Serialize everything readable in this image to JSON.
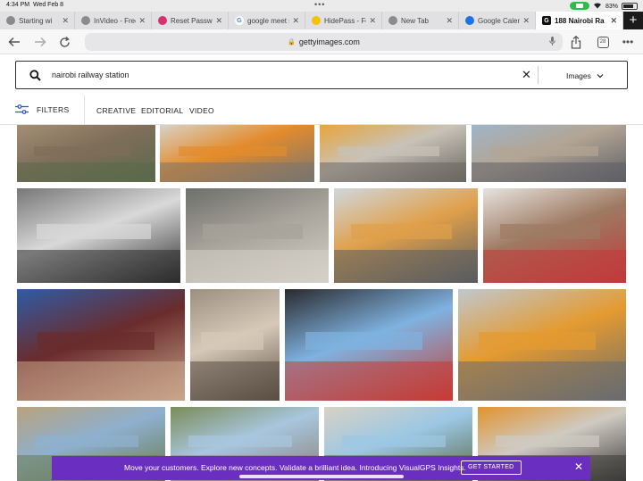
{
  "status": {
    "time": "4:34 PM",
    "date": "Wed Feb 8",
    "battery": "83%"
  },
  "tabs": [
    {
      "title": "Starting wi",
      "favicon": "globe-icon",
      "color": "#8a8a8a"
    },
    {
      "title": "InVideo - Free",
      "favicon": "globe-icon",
      "color": "#8a8a8a"
    },
    {
      "title": "Reset Passwo",
      "favicon": "instagram-icon",
      "color": "#d6306f"
    },
    {
      "title": "google meet s",
      "favicon": "google-icon",
      "color": "#4285f4"
    },
    {
      "title": "HidePass - Fo",
      "favicon": "hidepass-icon",
      "color": "#f3c200"
    },
    {
      "title": "New Tab",
      "favicon": "globe-icon",
      "color": "#8a8a8a"
    },
    {
      "title": "Google Calend",
      "favicon": "calendar-icon",
      "color": "#1a73e8"
    },
    {
      "title": "188 Nairobi Ra",
      "favicon": "getty-icon",
      "color": "#111111",
      "active": true
    }
  ],
  "toolbar": {
    "url": "gettyimages.com",
    "tab_count": "28"
  },
  "search": {
    "query": "nairobi railway station",
    "type": "Images"
  },
  "filters": {
    "label": "FILTERS",
    "tabs": [
      "CREATIVE",
      "EDITORIAL",
      "VIDEO"
    ]
  },
  "images": [
    {
      "row": 1,
      "subject": "railway-coaches-yard",
      "palette": [
        "#7f6e5a",
        "#a48f74",
        "#5a6a4a"
      ]
    },
    {
      "row": 1,
      "subject": "sgr-train-platform",
      "palette": [
        "#e38b2c",
        "#d7d2c6",
        "#7a7570"
      ]
    },
    {
      "row": 1,
      "subject": "train-at-platform",
      "palette": [
        "#c8c2b8",
        "#e8a53b",
        "#6b6660"
      ]
    },
    {
      "row": 1,
      "subject": "platform-passengers",
      "palette": [
        "#b3a594",
        "#9fb4c8",
        "#5e5f66"
      ]
    },
    {
      "row": 2,
      "subject": "historic-station-bw",
      "palette": [
        "#d9d9d9",
        "#777777",
        "#2b2b2b"
      ]
    },
    {
      "row": 2,
      "subject": "station-hall-interior",
      "palette": [
        "#a7a29a",
        "#6c6f6a",
        "#d5d0c8"
      ]
    },
    {
      "row": 2,
      "subject": "train-boarding-stairs",
      "palette": [
        "#e0a04a",
        "#cfd7de",
        "#5a5c60"
      ]
    },
    {
      "row": 2,
      "subject": "nairobi-sign-staff",
      "palette": [
        "#9e7a62",
        "#e7e3df",
        "#c13a3a"
      ]
    },
    {
      "row": 3,
      "subject": "disinfection-worker",
      "palette": [
        "#6a2c2c",
        "#2e5ba6",
        "#c9a58b"
      ]
    },
    {
      "row": 3,
      "subject": "foundation-stone",
      "palette": [
        "#d6c9b8",
        "#9c8f80",
        "#5a4e44"
      ]
    },
    {
      "row": 3,
      "subject": "officials-handshake",
      "palette": [
        "#7fb2e0",
        "#2a2a2e",
        "#c63b33"
      ]
    },
    {
      "row": 3,
      "subject": "train-arriving-platform",
      "palette": [
        "#e49a30",
        "#bfc8cf",
        "#6a6c6f"
      ]
    },
    {
      "row": 4,
      "subject": "construction-site",
      "palette": [
        "#8eb0cf",
        "#b9a27c",
        "#6a7a4c"
      ]
    },
    {
      "row": 4,
      "subject": "railway-tracks-landscape",
      "palette": [
        "#a8c6de",
        "#7b8c58",
        "#8a8176"
      ]
    },
    {
      "row": 4,
      "subject": "sgr-logo-monument",
      "palette": [
        "#9cc7e4",
        "#d8d2c4",
        "#5c6a4a"
      ]
    },
    {
      "row": 4,
      "subject": "train-doors-crowd",
      "palette": [
        "#cfcac2",
        "#e2932e",
        "#3c3a38"
      ]
    }
  ],
  "banner": {
    "message": "Move your customers. Explore new concepts. Validate a brilliant idea. Introducing VisualGPS Insights.",
    "cta": "GET STARTED",
    "color": "#6a2fc0"
  }
}
